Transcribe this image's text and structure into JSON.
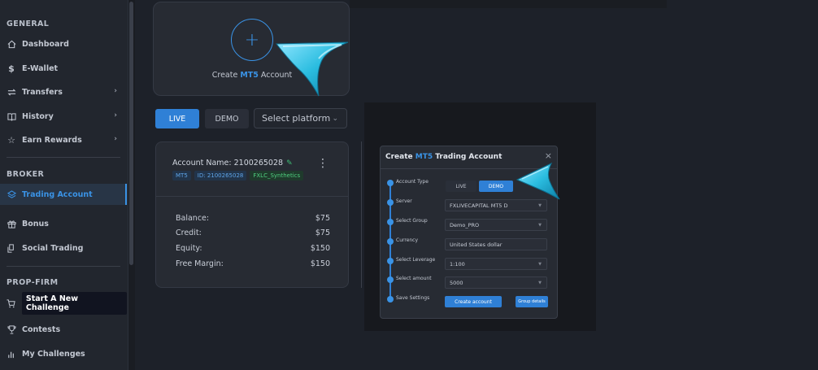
{
  "sidebar": {
    "general_title": "GENERAL",
    "broker_title": "BROKER",
    "propfirm_title": "PROP-FIRM",
    "items": [
      {
        "label": "Dashboard",
        "icon": "home-icon"
      },
      {
        "label": "E-Wallet",
        "icon": "dollar-icon"
      },
      {
        "label": "Transfers",
        "icon": "transfer-icon"
      },
      {
        "label": "History",
        "icon": "book-icon"
      },
      {
        "label": "Earn Rewards",
        "icon": "star-icon"
      },
      {
        "label": "Trading Account",
        "icon": "layers-icon"
      },
      {
        "label": "Bonus",
        "icon": "gift-icon"
      },
      {
        "label": "Social Trading",
        "icon": "copy-icon"
      },
      {
        "label": "Start A New Challenge",
        "icon": "cart-icon"
      },
      {
        "label": "Contests",
        "icon": "trophy-icon"
      },
      {
        "label": "My Challenges",
        "icon": "bar-chart-icon"
      }
    ]
  },
  "create_card": {
    "plus": "+",
    "text_prefix": "Create ",
    "text_brand": "MT5",
    "text_suffix": " Account"
  },
  "tabs": {
    "live": "LIVE",
    "demo": "DEMO",
    "platform_placeholder": "Select platform"
  },
  "account": {
    "name": "Account Name: 2100265028",
    "badge_platform": "MT5",
    "badge_id": "ID: 2100265028",
    "badge_symbol": "FXLC_Synthetics",
    "rows": [
      {
        "label": "Balance:",
        "value": "$75"
      },
      {
        "label": "Credit:",
        "value": "$75"
      },
      {
        "label": "Equity:",
        "value": "$150"
      },
      {
        "label": "Free Margin:",
        "value": "$150"
      }
    ]
  },
  "modal": {
    "title_prefix": "Create ",
    "title_brand": "MT5",
    "title_suffix": " Trading Account",
    "close": "×",
    "steps": [
      "Account Type",
      "Server",
      "Select Group",
      "Currency",
      "Select Leverage",
      "Select amount",
      "Save Settings"
    ],
    "live": "LIVE",
    "demo": "DEMO",
    "server": "FXLIVECAPITAL MT5 D",
    "group": "Demo_PRO",
    "currency": "United States dollar",
    "leverage": "1:100",
    "amount": "5000",
    "create_button": "Create account",
    "group_details_button": "Group details"
  },
  "colors": {
    "accent": "#3a93e6",
    "background": "#1d2129",
    "card": "#272b33"
  }
}
